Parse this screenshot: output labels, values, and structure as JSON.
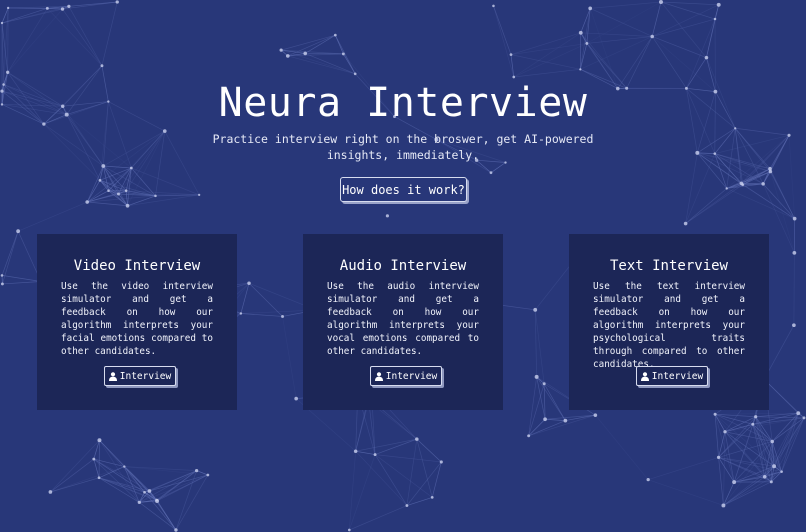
{
  "hero": {
    "title": "Neura Interview",
    "subtitle": "Practice interview right on the broswer, get AI-powered insights, immediately.",
    "how_button": "How does it work?"
  },
  "cards": [
    {
      "title": "Video Interview",
      "description": "Use the video interview simulator and get a feedback on how our algorithm interprets your facial emotions compared to other candidates.",
      "button_label": "Interview",
      "button_icon": "user-icon"
    },
    {
      "title": "Audio Interview",
      "description": "Use the audio interview simulator and get a feedback on how our algorithm interprets your vocal emotions compared to other candidates.",
      "button_label": "Interview",
      "button_icon": "user-icon"
    },
    {
      "title": "Text Interview",
      "description": "Use the text interview simulator and get a feedback on how our algorithm interprets your psychological traits through compared to other candidates.",
      "button_label": "Interview",
      "button_icon": "user-icon"
    }
  ],
  "colors": {
    "background": "#283779",
    "card": "#1c2657",
    "text": "#ffffff",
    "network_lines": "#5b6bb0",
    "network_nodes": "#c9d0ee"
  }
}
